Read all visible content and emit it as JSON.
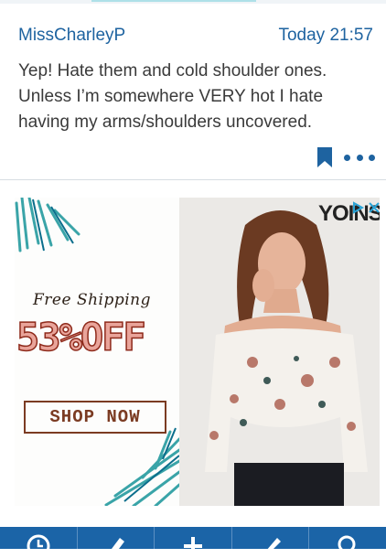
{
  "post": {
    "author": "MissCharleyP",
    "time": "Today 21:57",
    "body": "Yep! Hate them and cold shoulder ones. Unless I’m somewhere VERY hot I hate having my arms/shoulders uncovered."
  },
  "ad": {
    "free_shipping": "Free Shipping",
    "discount": "53%OFF",
    "shop_now": "SHOP NOW",
    "brand": "YOINS"
  },
  "colors": {
    "accent": "#1e63a0",
    "bottom_bar": "#1b64a7",
    "discount_fill": "#e9a49a",
    "discount_stroke": "#8e2a1b"
  },
  "icons": [
    "bookmark-icon",
    "more-icon",
    "adchoices-icon",
    "close-icon",
    "clock-icon",
    "pencil-icon",
    "plus-icon",
    "pin-icon",
    "search-icon"
  ]
}
